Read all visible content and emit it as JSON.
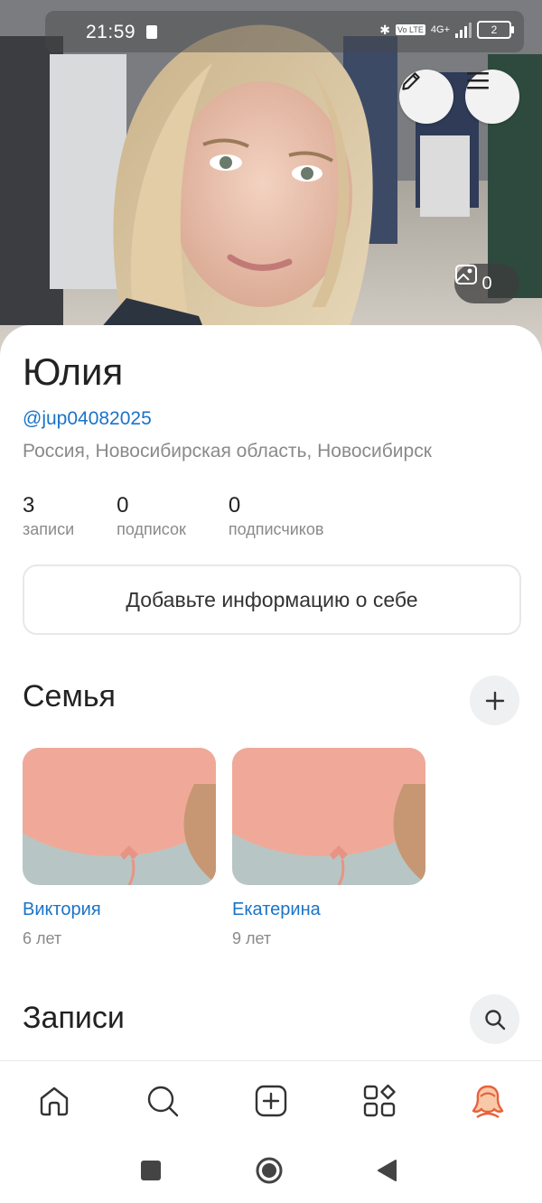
{
  "status_bar": {
    "time": "21:59",
    "network": "4G+",
    "volte": "Vo LTE",
    "battery": "2"
  },
  "cover": {
    "photos_count": "0"
  },
  "profile": {
    "name": "Юлия",
    "handle": "@jup04082025",
    "location": "Россия, Новосибирская область, Новосибирск",
    "stats": [
      {
        "value": "3",
        "label": "записи"
      },
      {
        "value": "0",
        "label": "подписок"
      },
      {
        "value": "0",
        "label": "подписчиков"
      }
    ],
    "about_button": "Добавьте информацию о себе"
  },
  "family": {
    "title": "Семья",
    "members": [
      {
        "name": "Виктория",
        "age": "6 лет"
      },
      {
        "name": "Екатерина",
        "age": "9 лет"
      }
    ]
  },
  "posts": {
    "title": "Записи"
  },
  "bottom_nav": {
    "items": [
      "home-icon",
      "search-icon",
      "add-post-icon",
      "services-icon",
      "profile-icon"
    ],
    "active_color": "#e8613c"
  },
  "colors": {
    "accent_link": "#1a73c9",
    "secondary_text": "#8a8a8a",
    "border": "#e6e8ea"
  }
}
